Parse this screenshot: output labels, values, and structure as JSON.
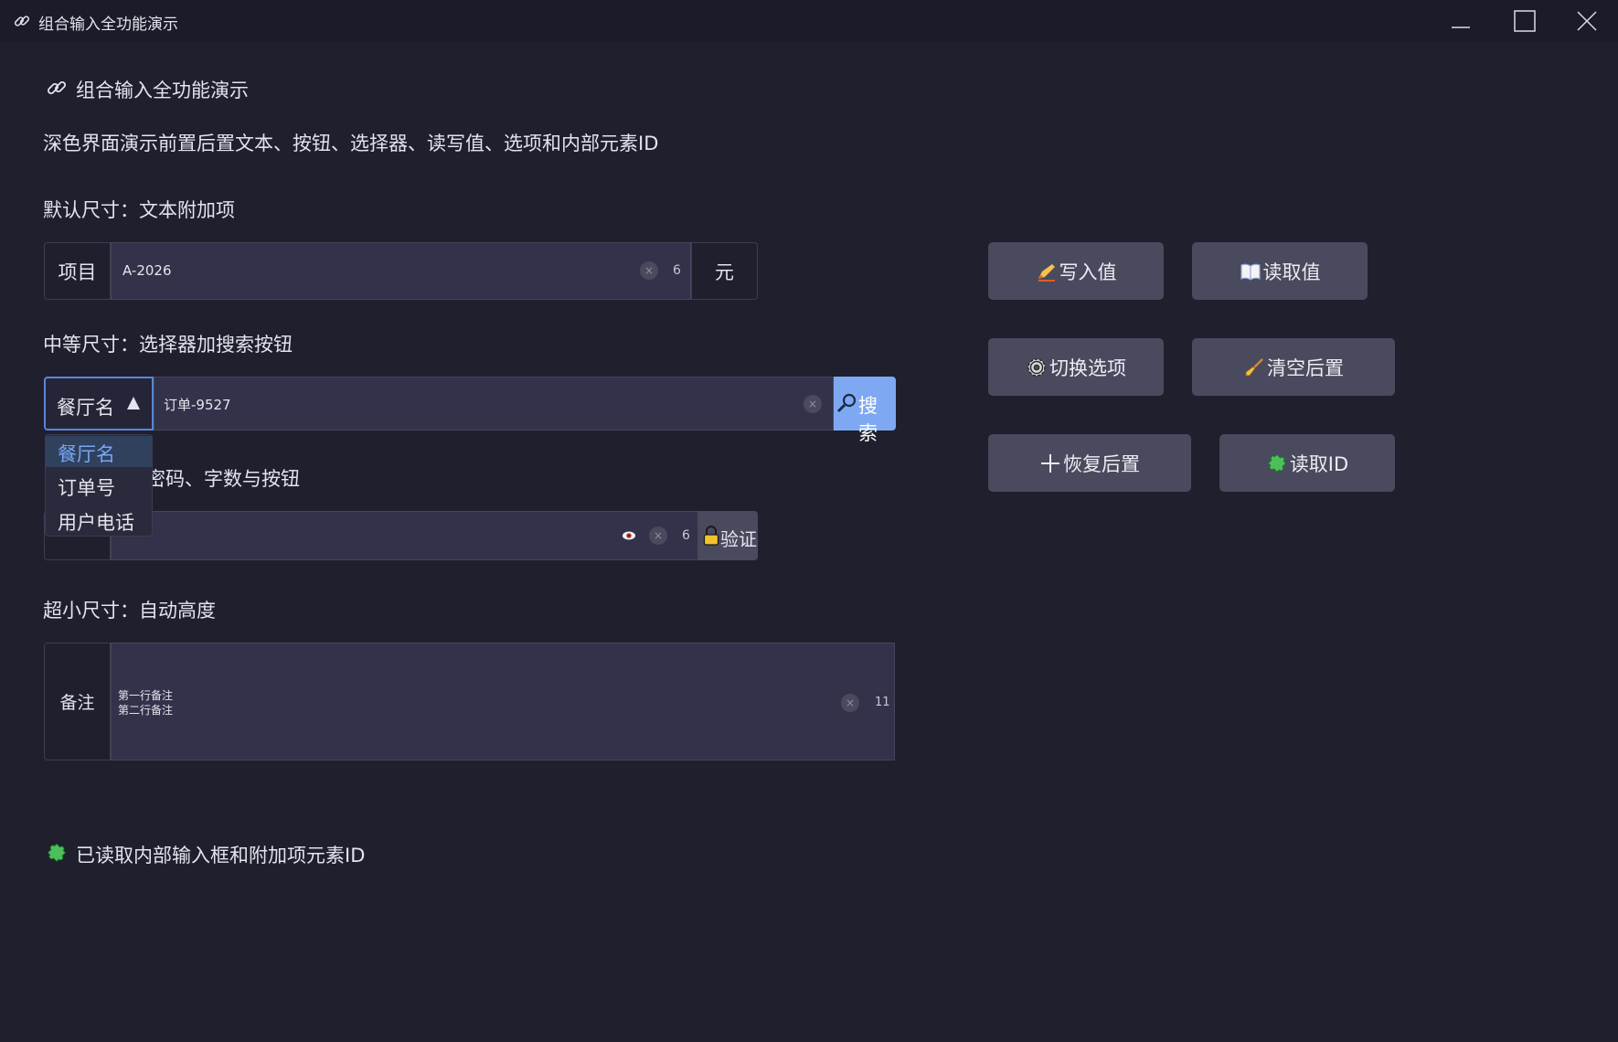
{
  "window": {
    "title": "组合输入全功能演示"
  },
  "header": {
    "title": "组合输入全功能演示",
    "subtitle": "深色界面演示前置后置文本、按钮、选择器、读写值、选项和内部元素ID"
  },
  "sections": {
    "default": {
      "label": "默认尺寸：文本附加项",
      "prefix": "项目",
      "value": "A-2026",
      "count": "6",
      "suffix": "元"
    },
    "medium": {
      "label": "中等尺寸：选择器加搜索按钮",
      "select_value": "餐厅名",
      "value": "订单-9527",
      "button_label": "搜索"
    },
    "small": {
      "label_visible": "密码、字数与按钮",
      "count": "6",
      "button_label": "验证"
    },
    "mini": {
      "label": "超小尺寸：自动高度",
      "prefix": "备注",
      "line1": "第一行备注",
      "line2": "第二行备注",
      "count": "11"
    }
  },
  "dropdown": {
    "options": [
      "餐厅名",
      "订单号",
      "用户电话"
    ],
    "selected_index": 0
  },
  "actions": {
    "write_value": "写入值",
    "read_value": "读取值",
    "toggle_option": "切换选项",
    "clear_suffix": "清空后置",
    "restore_suffix": "恢复后置",
    "read_id": "读取ID"
  },
  "status": {
    "message": "已读取内部输入框和附加项元素ID"
  },
  "colors": {
    "background": "#1f1f2e",
    "field": "#32324a",
    "button": "#4a4a5e",
    "accent": "#7ea9f2",
    "select_border": "#5a86d8"
  }
}
